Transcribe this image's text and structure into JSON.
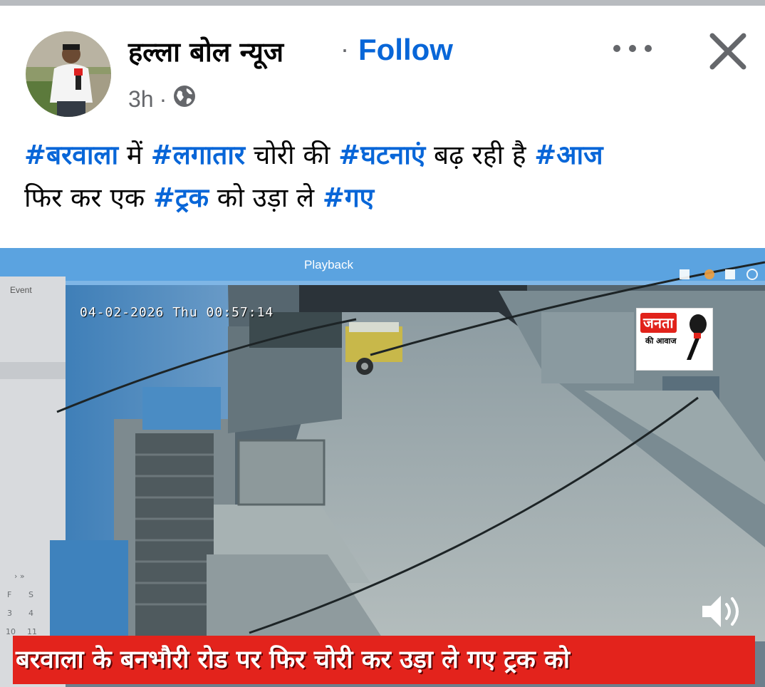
{
  "post": {
    "page_name": "हल्ला बोल न्यूज",
    "separator": "·",
    "follow_label": "Follow",
    "time": "3h",
    "meta_separator": "·",
    "privacy_icon": "globe-icon",
    "caption_lines": [
      [
        {
          "text": "#बरवाला",
          "hashtag": true
        },
        {
          "text": " में ",
          "hashtag": false
        },
        {
          "text": "#लगातार",
          "hashtag": true
        },
        {
          "text": " चोरी की ",
          "hashtag": false
        },
        {
          "text": "#घटनाएं",
          "hashtag": true
        },
        {
          "text": " बढ़ रही है ",
          "hashtag": false
        },
        {
          "text": "#आज",
          "hashtag": true
        }
      ],
      [
        {
          "text": "फिर कर एक ",
          "hashtag": false
        },
        {
          "text": "#ट्रक",
          "hashtag": true
        },
        {
          "text": " को उड़ा ले ",
          "hashtag": false
        },
        {
          "text": "#गए",
          "hashtag": true
        }
      ]
    ]
  },
  "video": {
    "playback_label": "Playback",
    "event_label": "Event",
    "timestamp": "04-02-2026 Thu 00:57:14",
    "logo_line1": "जनता",
    "logo_line2": "की आवाज",
    "banner_text": "बरवाला के बनभौरी रोड पर फिर चोरी कर उड़ा ले गए ट्रक को",
    "volume_icon": "volume-icon"
  },
  "icons": {
    "more": "more-options-icon",
    "close": "close-icon"
  },
  "colors": {
    "link_blue": "#0866d8",
    "secondary_text": "#65676b",
    "banner_red": "#e3231c"
  }
}
